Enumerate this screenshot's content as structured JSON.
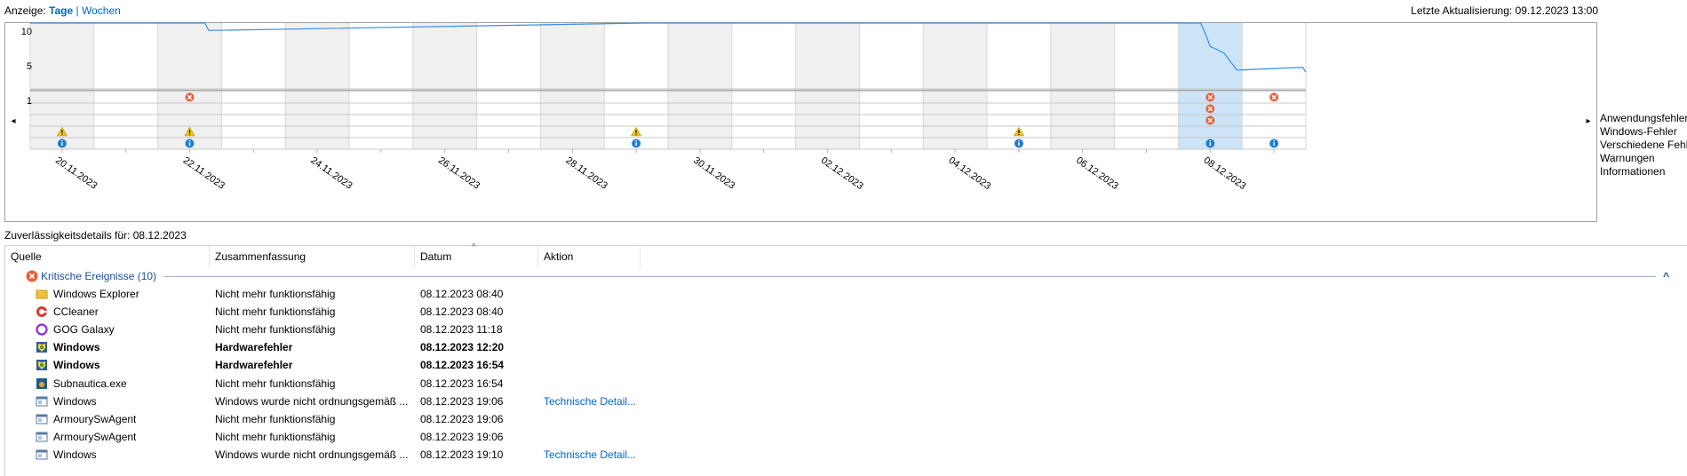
{
  "toolbar": {
    "view_label": "Anzeige:",
    "view_days": "Tage",
    "separator": "|",
    "view_weeks": "Wochen",
    "last_update": "Letzte Aktualisierung: 09.12.2023 13:00"
  },
  "chart": {
    "y_ticks": [
      "10",
      "5",
      "1"
    ],
    "selected_day_index": 18,
    "nav_left": "◂",
    "nav_right": "▸"
  },
  "chart_data": {
    "type": "line",
    "days": 20,
    "ylim": [
      1,
      10
    ],
    "stability_index": [
      {
        "x": 0,
        "y": 10
      },
      {
        "x": 2.74,
        "y": 10
      },
      {
        "x": 2.8,
        "y": 8.9
      },
      {
        "x": 9.6,
        "y": 10
      },
      {
        "x": 18.35,
        "y": 10
      },
      {
        "x": 18.4,
        "y": 9
      },
      {
        "x": 18.5,
        "y": 6.5
      },
      {
        "x": 18.6,
        "y": 6.1
      },
      {
        "x": 18.72,
        "y": 5.5
      },
      {
        "x": 18.8,
        "y": 4.5
      },
      {
        "x": 18.92,
        "y": 3.0
      },
      {
        "x": 19.95,
        "y": 3.4
      },
      {
        "x": 20,
        "y": 2.7
      }
    ],
    "date_labels": [
      "20.11.2023",
      "22.11.2023",
      "24.11.2023",
      "26.11.2023",
      "28.11.2023",
      "30.11.2023",
      "02.12.2023",
      "04.12.2023",
      "06.12.2023",
      "08.12.2023"
    ],
    "legend": [
      "Anwendungsfehler",
      "Windows-Fehler",
      "Verschiedene Fehler",
      "Warnungen",
      "Informationen"
    ],
    "events": {
      "application_errors": [
        2,
        18,
        19
      ],
      "windows_errors": [
        18
      ],
      "misc_errors": [
        18
      ],
      "warnings": [
        0,
        2,
        9,
        15
      ],
      "information": [
        0,
        2,
        9,
        15,
        18,
        19
      ]
    }
  },
  "details": {
    "title": "Zuverlässigkeitsdetails für: 08.12.2023",
    "columns": [
      "Quelle",
      "Zusammenfassung",
      "Datum",
      "Aktion"
    ],
    "sort_arrow": "^",
    "group": {
      "label": "Kritische Ereignisse (10)",
      "collapse_glyph": "^"
    },
    "rows": [
      {
        "icon": "folder-icon",
        "source": "Windows Explorer",
        "summary": "Nicht mehr funktionsfähig",
        "date": "08.12.2023 08:40",
        "action": "",
        "bold": false
      },
      {
        "icon": "ccleaner-icon",
        "source": "CCleaner",
        "summary": "Nicht mehr funktionsfähig",
        "date": "08.12.2023 08:40",
        "action": "",
        "bold": false
      },
      {
        "icon": "gog-galaxy-icon",
        "source": "GOG Galaxy",
        "summary": "Nicht mehr funktionsfähig",
        "date": "08.12.2023 11:18",
        "action": "",
        "bold": false
      },
      {
        "icon": "windows-shield-icon",
        "source": "Windows",
        "summary": "Hardwarefehler",
        "date": "08.12.2023 12:20",
        "action": "",
        "bold": true
      },
      {
        "icon": "windows-shield-icon",
        "source": "Windows",
        "summary": "Hardwarefehler",
        "date": "08.12.2023 16:54",
        "action": "",
        "bold": true
      },
      {
        "icon": "subnautica-icon",
        "source": "Subnautica.exe",
        "summary": "Nicht mehr funktionsfähig",
        "date": "08.12.2023 16:54",
        "action": "",
        "bold": false
      },
      {
        "icon": "application-icon",
        "source": "Windows",
        "summary": "Windows wurde nicht ordnungsgemäß ...",
        "date": "08.12.2023 19:06",
        "action": "Technische Detail...",
        "bold": false
      },
      {
        "icon": "application-icon",
        "source": "ArmourySwAgent",
        "summary": "Nicht mehr funktionsfähig",
        "date": "08.12.2023 19:06",
        "action": "",
        "bold": false
      },
      {
        "icon": "application-icon",
        "source": "ArmourySwAgent",
        "summary": "Nicht mehr funktionsfähig",
        "date": "08.12.2023 19:06",
        "action": "",
        "bold": false
      },
      {
        "icon": "application-icon",
        "source": "Windows",
        "summary": "Windows wurde nicht ordnungsgemäß ...",
        "date": "08.12.2023 19:10",
        "action": "Technische Detail...",
        "bold": false
      }
    ]
  },
  "colors": {
    "line": "#3a8ee6",
    "gray_col": "#f0f0f0",
    "selected_col": "#cce4f7",
    "error": "#e8613a",
    "warning": "#f5c800",
    "info": "#1e7fd1",
    "link": "#0066cc"
  }
}
